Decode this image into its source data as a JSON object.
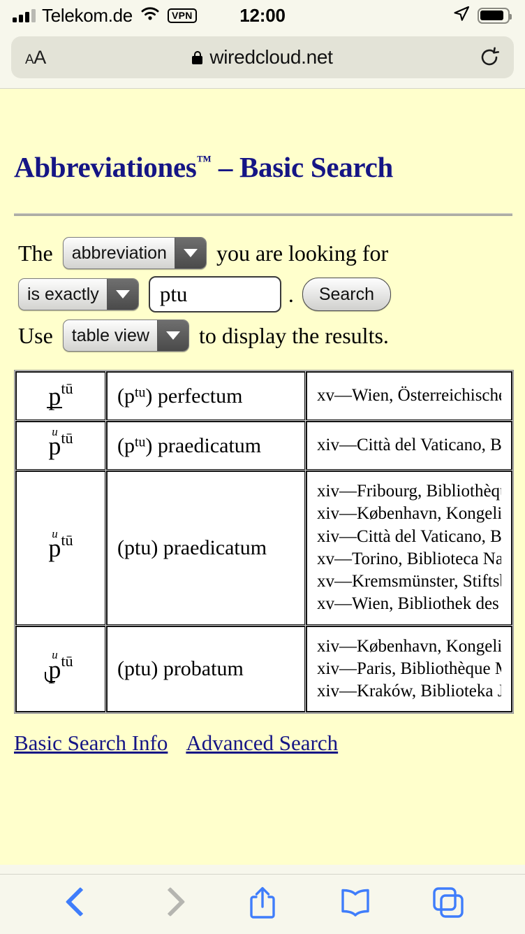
{
  "status_bar": {
    "carrier": "Telekom.de",
    "vpn_badge": "VPN",
    "time": "12:00",
    "signal_icon": "signal-bars-icon",
    "wifi_icon": "wifi-icon",
    "location_icon": "location-arrow-icon",
    "battery_icon": "battery-icon"
  },
  "browser": {
    "text_size_button": "AA",
    "url": "wiredcloud.net",
    "lock_icon": "lock-icon",
    "reload_icon": "reload-icon",
    "toolbar": {
      "back": "back-chevron-icon",
      "forward": "forward-chevron-icon",
      "share": "share-icon",
      "bookmarks": "book-icon",
      "tabs": "tabs-icon"
    }
  },
  "page": {
    "title": "Abbreviationes",
    "title_tm": "™",
    "title_rest": " – Basic Search",
    "form": {
      "prefix": "The",
      "field_select": "abbreviation",
      "middle": "you are looking for",
      "match_select": "is exactly",
      "query_value": "ptu",
      "period": ".",
      "search_button": "Search",
      "use_label": "Use",
      "view_select": "table view",
      "use_suffix": "to display the results."
    },
    "results": [
      {
        "abbr_base": "p",
        "abbr_mark": "stroke",
        "abbr_sup": "tū",
        "expansion_head": "(p",
        "expansion_sup": "tu",
        "expansion_tail": ") perfectum",
        "sources": [
          "xv—Wien, Österreichische Nationa"
        ]
      },
      {
        "abbr_base": "p",
        "abbr_mark": "overu",
        "abbr_sup": "tū",
        "expansion_head": "(p",
        "expansion_sup": "tu",
        "expansion_tail": ") praedicatum",
        "sources": [
          "xiv—Città del Vaticano, Biblioteca"
        ]
      },
      {
        "abbr_base": "p",
        "abbr_mark": "overu",
        "abbr_sup": "tū",
        "expansion_head": "(ptu",
        "expansion_sup": "",
        "expansion_tail": ") praedicatum",
        "sources": [
          "xiv—Fribourg, Bibliothèque des Co",
          "xiv—København, Kongelige Biblio",
          "xiv—Città del Vaticano, Biblioteca",
          "xv—Torino, Biblioteca Nazionale, (",
          "xv—Kremsmünster, Stiftsbibliothek",
          "xv—Wien, Bibliothek des Dominik"
        ]
      },
      {
        "abbr_base": "p",
        "abbr_mark": "overu-hook",
        "abbr_sup": "tū",
        "expansion_head": "(ptu",
        "expansion_sup": "",
        "expansion_tail": ") probatum",
        "sources": [
          "xiv—København, Kongelige Biblio",
          "xiv—Paris, Bibliothèque Mazarine,",
          "xiv—Kraków, Biblioteka Jagiellońs"
        ]
      }
    ],
    "links": [
      {
        "label": "Basic Search Info"
      },
      {
        "label": "Advanced Search"
      }
    ]
  },
  "colors": {
    "page_bg": "#ffffcc",
    "chrome_bg": "#f7f7ec",
    "link": "#151585",
    "heading": "#151585",
    "toolbar_active": "#3f7dfb",
    "toolbar_disabled": "#b5b5b0",
    "urlbar_field": "#e3e3d7"
  }
}
